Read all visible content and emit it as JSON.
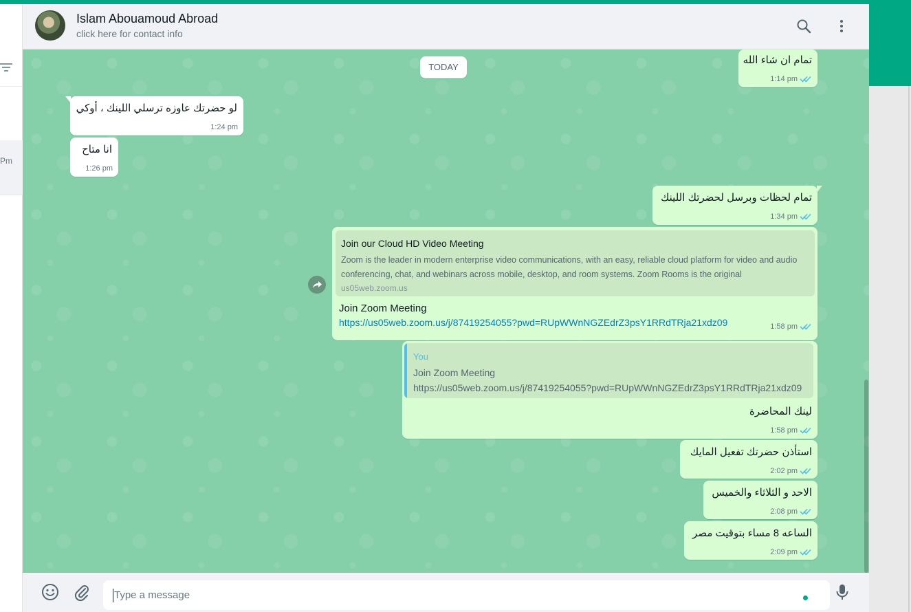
{
  "header": {
    "contact_name": "Islam Abouamoud Abroad",
    "contact_sub": "click here for contact info",
    "search_icon": "search-icon",
    "menu_icon": "kebab-menu-icon"
  },
  "sidebar": {
    "visible_time": "Pm"
  },
  "chat": {
    "date_chip": "TODAY",
    "messages": [
      {
        "dir": "out",
        "text": "تمام ان شاء الله",
        "time": "1:14 pm",
        "ticks": "read"
      },
      {
        "dir": "in",
        "text": "لو حضرتك عاوزه ترسلي اللينك ، أوكي",
        "time": "1:24 pm"
      },
      {
        "dir": "in",
        "text": "انا متاح",
        "time": "1:26 pm"
      },
      {
        "dir": "out",
        "text": "تمام لحظات وبرسل لحضرتك اللينك",
        "time": "1:34 pm",
        "ticks": "read"
      },
      {
        "dir": "out",
        "preview": {
          "title": "Join our Cloud HD Video Meeting",
          "description": "Zoom is the leader in modern enterprise video communications, with an easy, reliable cloud platform for video and audio conferencing, chat, and webinars across mobile, desktop, and room systems. Zoom Rooms is the original",
          "domain": "us05web.zoom.us"
        },
        "link_title": "Join Zoom Meeting",
        "link_url": "https://us05web.zoom.us/j/87419254055?pwd=RUpWWnNGZEdrZ3psY1RRdTRja21xdz09",
        "time": "1:58 pm",
        "ticks": "read"
      },
      {
        "dir": "out",
        "quote": {
          "author": "You",
          "line1": "Join Zoom Meeting",
          "line2": "https://us05web.zoom.us/j/87419254055?pwd=RUpWWnNGZEdrZ3psY1RRdTRja21xdz09"
        },
        "text": "لينك المحاضرة",
        "time": "1:58 pm",
        "ticks": "read"
      },
      {
        "dir": "out",
        "text": "استأذن حضرتك تفعيل المايك",
        "time": "2:02 pm",
        "ticks": "read"
      },
      {
        "dir": "out",
        "text": "الاحد و الثلاثاء والخميس",
        "time": "2:08 pm",
        "ticks": "read"
      },
      {
        "dir": "out",
        "text": "الساعه 8 مساء بتوقيت مصر",
        "time": "2:09 pm",
        "ticks": "read"
      }
    ]
  },
  "footer": {
    "placeholder": "Type a message",
    "emoji_icon": "emoji-icon",
    "attach_icon": "paperclip-icon",
    "mic_icon": "microphone-icon"
  },
  "colors": {
    "accent": "#00a884",
    "outgoing_bubble": "#d9fdd3",
    "incoming_bubble": "#ffffff",
    "chat_background": "#85cfa9",
    "read_ticks": "#53bdeb",
    "link": "#027eb5"
  }
}
